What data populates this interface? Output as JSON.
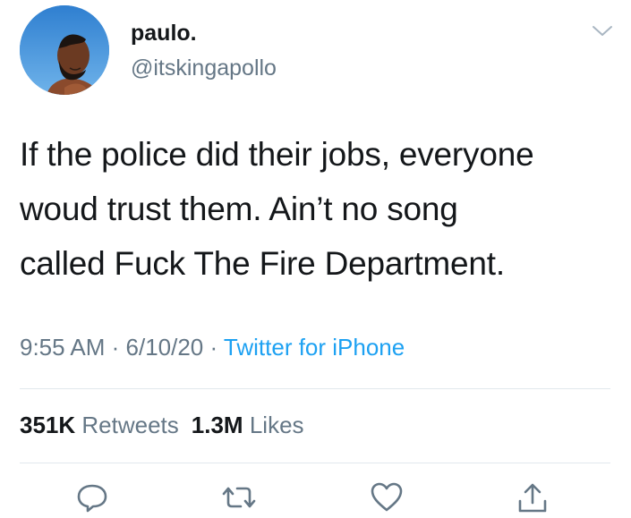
{
  "user": {
    "name": "paulo.",
    "handle": "@itskingapollo"
  },
  "tweet": {
    "lines": [
      "If the police did their jobs, everyone",
      "woud trust them. Ain’t no song",
      "called Fuck The Fire Department."
    ]
  },
  "meta": {
    "time": "9:55 AM",
    "separator": " · ",
    "date": "6/10/20",
    "source": "Twitter for iPhone"
  },
  "stats": {
    "retweets_count": "351K",
    "retweets_label": "Retweets",
    "likes_count": "1.3M",
    "likes_label": "Likes"
  },
  "actions": {
    "icons": [
      "reply-icon",
      "retweet-icon",
      "like-icon",
      "share-icon"
    ]
  },
  "colors": {
    "text": "#14171a",
    "secondary": "#657786",
    "link": "#1da1f2",
    "divider": "#e1e8ed"
  }
}
